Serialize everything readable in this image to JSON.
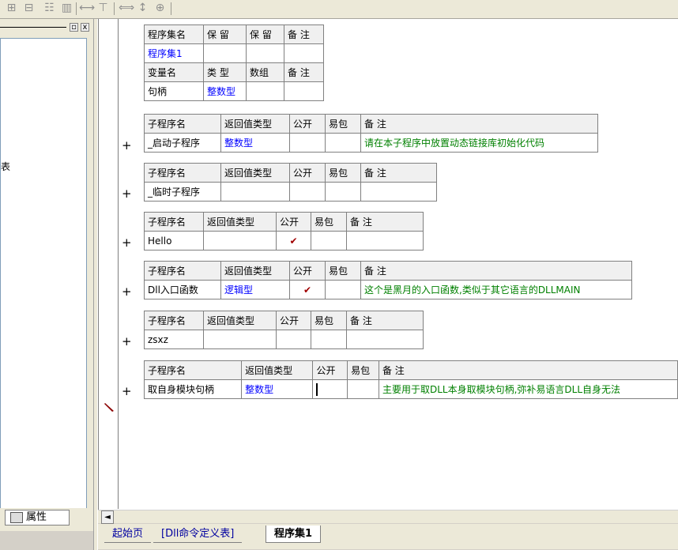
{
  "toolbar": {
    "icons": [
      "insert-row-icon",
      "insert-table-icon",
      "align-top-icon",
      "align-middle-icon",
      "align-left-icon",
      "align-center-icon",
      "expand-width-icon",
      "expand-height-icon",
      "expand-all-icon"
    ],
    "glyphs": [
      "⊞",
      "⊟",
      "☷",
      "▥",
      "⟷",
      "⊤",
      "⟺",
      "↕",
      "⊕"
    ]
  },
  "left_panel": {
    "fragment_text": "表",
    "minimize_glyph": "▫",
    "close_glyph": "x",
    "properties_tab_label": "属性"
  },
  "assembly_table": {
    "headers": [
      "程序集名",
      "保 留",
      "保 留",
      "备 注"
    ],
    "row": [
      "程序集1",
      "",
      "",
      ""
    ]
  },
  "variable_table": {
    "headers": [
      "变量名",
      "类 型",
      "数组",
      "备 注"
    ],
    "row": [
      "句柄",
      "整数型",
      "",
      ""
    ]
  },
  "subroutine_headers": [
    "子程序名",
    "返回值类型",
    "公开",
    "易包",
    "备 注"
  ],
  "subroutines": [
    {
      "name": "_启动子程序",
      "return_type": "整数型",
      "public": "",
      "easy_pkg": "",
      "remark": "请在本子程序中放置动态链接库初始化代码",
      "expander": "+"
    },
    {
      "name": "_临时子程序",
      "return_type": "",
      "public": "",
      "easy_pkg": "",
      "remark": "",
      "expander": "+"
    },
    {
      "name": "Hello",
      "return_type": "",
      "public": "✔",
      "easy_pkg": "",
      "remark": "",
      "expander": "+"
    },
    {
      "name": "Dll入口函数",
      "return_type": "逻辑型",
      "public": "✔",
      "easy_pkg": "",
      "remark": "这个是黑月的入口函数,类似于其它语言的DLLMAIN",
      "expander": "+"
    },
    {
      "name": "zsxz",
      "return_type": "",
      "public": "",
      "easy_pkg": "",
      "remark": "",
      "expander": "+"
    },
    {
      "name": "取自身模块句柄",
      "return_type": "整数型",
      "public": "",
      "easy_pkg": "",
      "remark": "主要用于取DLL本身取模块句柄,弥补易语言DLL自身无法",
      "expander": "+"
    }
  ],
  "scroll": {
    "left_arrow": "◄"
  },
  "doc_tabs": [
    "起始页",
    "[Dll命令定义表]",
    "程序集1"
  ],
  "active_doc_tab": "程序集1"
}
